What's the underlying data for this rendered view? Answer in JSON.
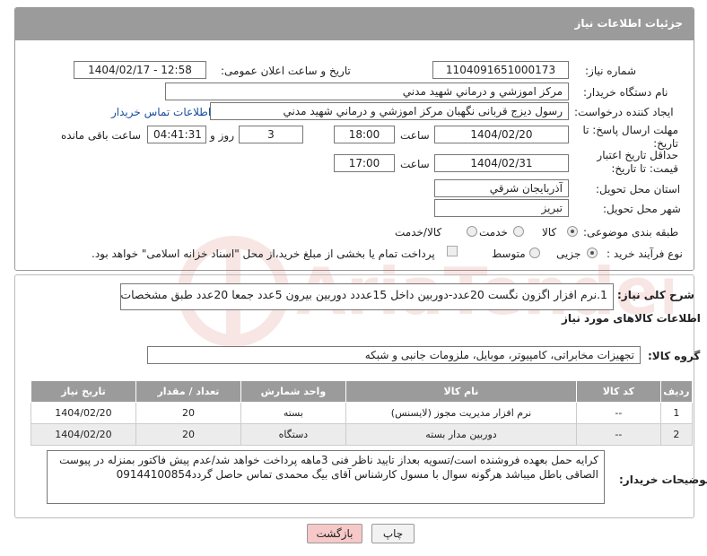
{
  "header": {
    "title": "جزئیات اطلاعات نیاز"
  },
  "fields": {
    "need_number_label": "شماره نیاز:",
    "need_number": "1104091651000173",
    "announce_label": "تاریخ و ساعت اعلان عمومی:",
    "announce_value": "1404/02/17 - 12:58",
    "buyer_org_label": "نام دستگاه خریدار:",
    "buyer_org": "مرکز اموزشي و درماني شهيد مدني",
    "requester_label": "ایجاد کننده درخواست:",
    "requester": "رسول دیزج قربانی نگهبان مرکز اموزشي و درماني شهيد مدني",
    "contact_link": "اطلاعات تماس خریدار",
    "deadline_label": "مهلت ارسال پاسخ: تا تاریخ:",
    "deadline_date": "1404/02/20",
    "time_label": "ساعت",
    "deadline_time": "18:00",
    "days_value": "3",
    "days_label": "روز و",
    "remaining_time": "04:41:31",
    "remaining_label": "ساعت باقی مانده",
    "validity_label": "حداقل تاریخ اعتبار قیمت: تا تاریخ:",
    "validity_date": "1404/02/31",
    "validity_time": "17:00",
    "province_label": "استان محل تحویل:",
    "province": "آذربايجان شرقي",
    "city_label": "شهر محل تحویل:",
    "city": "تبريز",
    "category_label": "طبقه بندی موضوعی:",
    "category_options": [
      "کالا",
      "خدمت",
      "کالا/خدمت"
    ],
    "purchase_type_label": "نوع فرآیند خرید :",
    "purchase_options": [
      "جزیی",
      "متوسط"
    ],
    "payment_note": "پرداخت تمام یا بخشی از مبلغ خرید،از محل \"اسناد خزانه اسلامی\" خواهد بود."
  },
  "summary": {
    "label": "شرح کلی نیاز:",
    "text": "1.نرم افزار اگزون نگست 20عدد-دوربین داخل 15عددد دوربین بیرون 5عدد جمعا 20عدد طبق مشخصات پیوستی"
  },
  "goods": {
    "section_title": "اطلاعات کالاهای مورد نیاز",
    "group_label": "گروه کالا:",
    "group_value": "تجهیزات مخابراتی، کامپیوتر، موبایل، ملزومات جانبی و شبکه"
  },
  "table": {
    "headers": [
      "ردیف",
      "کد کالا",
      "نام کالا",
      "واحد شمارش",
      "تعداد / مقدار",
      "تاریخ نیاز"
    ],
    "rows": [
      [
        "1",
        "--",
        "نرم افزار مدیریت مجوز (لایسنس)",
        "بسته",
        "20",
        "1404/02/20"
      ],
      [
        "2",
        "--",
        "دوربین مدار بسته",
        "دستگاه",
        "20",
        "1404/02/20"
      ]
    ]
  },
  "buyer_notes": {
    "label": "توضیحات خریدار:",
    "text": "کرایه حمل بعهده فروشنده است/تسویه بعداز تایید ناظر فنی 3ماهه پرداخت خواهد شد/عدم پیش فاکتور بمنزله در پیوست الصاقی باطل میباشد هرگونه سوال با مسول کارشناس آقای بیگ محمدی تماس حاصل گردد09144100854"
  },
  "buttons": {
    "print": "چاپ",
    "back": "بازگشت"
  },
  "colors": {
    "header_bg": "#9b9b9b",
    "back_button_bg": "#f6c8c8",
    "link": "#1a4fa0"
  }
}
